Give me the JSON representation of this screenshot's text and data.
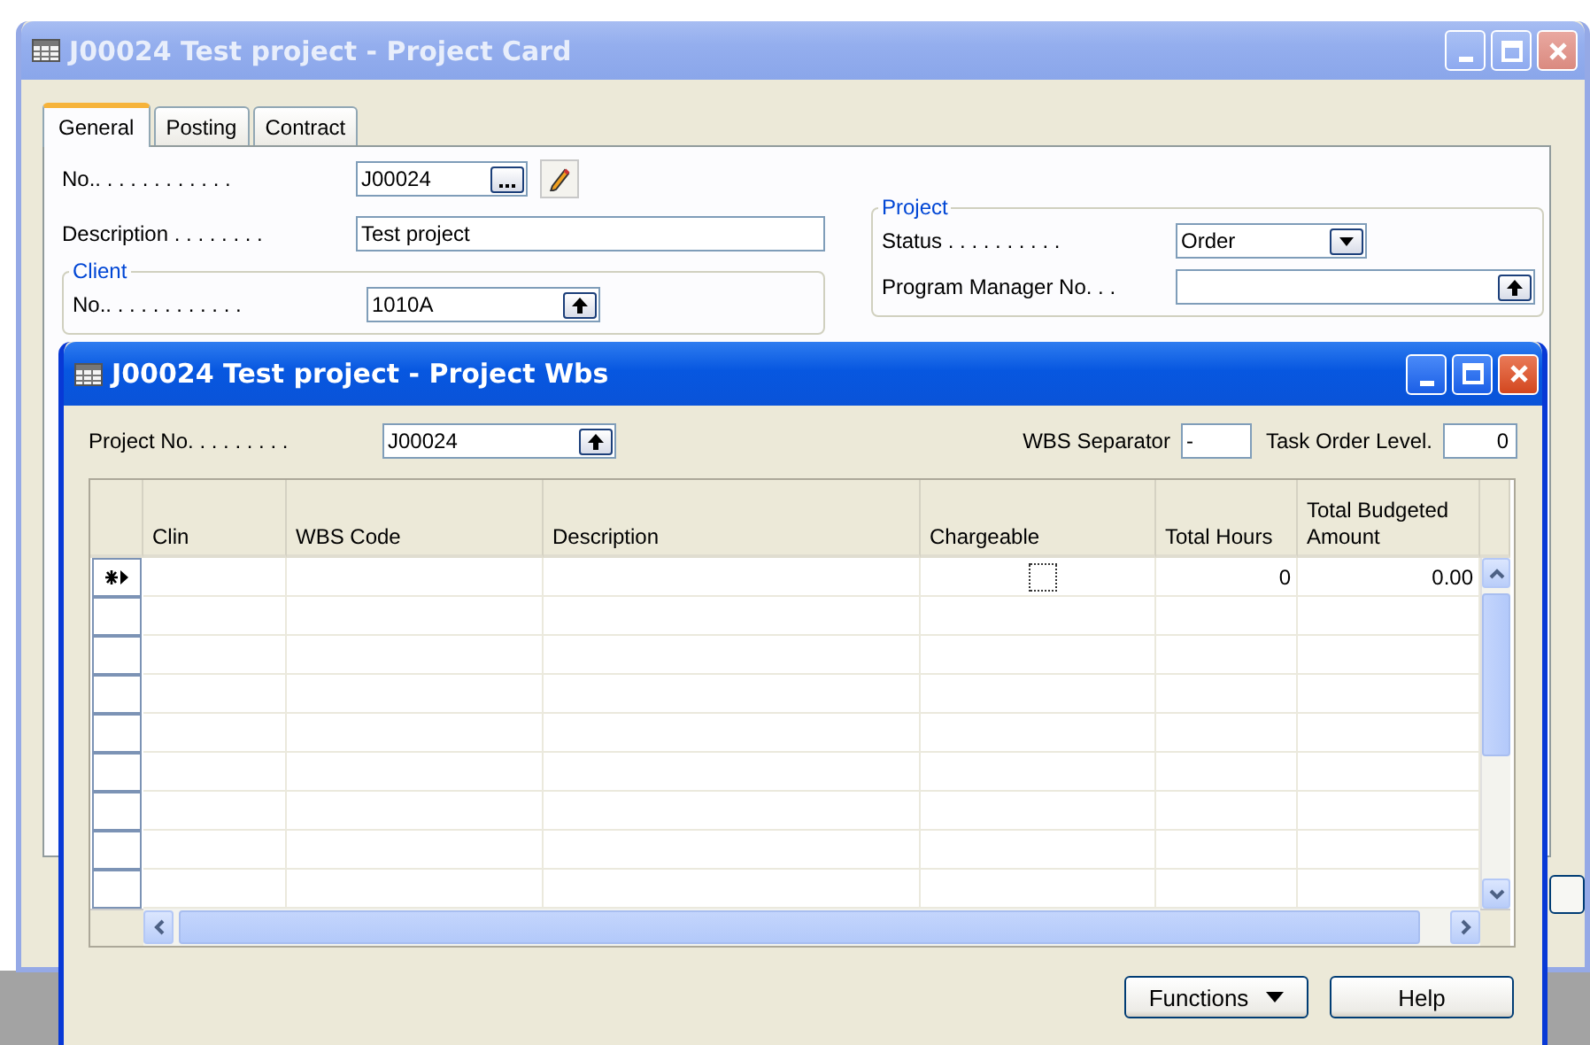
{
  "back_window": {
    "title": "J00024 Test project - Project Card",
    "active": false,
    "tabs": [
      {
        "label": "General",
        "selected": true
      },
      {
        "label": "Posting",
        "selected": false
      },
      {
        "label": "Contract",
        "selected": false
      }
    ],
    "fields": [
      {
        "label": "No.. . . . . . . . . . . .",
        "value": "J00024",
        "kind": "assist"
      },
      {
        "label": "Description . . . . . . . .",
        "value": "Test project",
        "kind": "text"
      }
    ],
    "client_group": {
      "title": "Client",
      "fields": [
        {
          "label": "No.. . . . . . . . . . . .",
          "value": "1010A",
          "kind": "lookup"
        }
      ]
    },
    "project_group": {
      "title": "Project",
      "fields": [
        {
          "label": "Status . . . . . . . . . .",
          "value": "Order",
          "kind": "dropdown"
        },
        {
          "label": "Program Manager No. . .",
          "kind": "lookup"
        }
      ]
    }
  },
  "front_window": {
    "title": "J00024 Test project - Project Wbs",
    "active": true,
    "project_no": {
      "label": "Project No. . . . . . . . .",
      "value": "J00024"
    },
    "wbs_separator": {
      "label": "WBS Separator",
      "value": "-"
    },
    "task_order_level": {
      "label": "Task Order Level.",
      "value": "0"
    },
    "table": {
      "columns": [
        "Clin",
        "WBS Code",
        "Description",
        "Chargeable",
        "Total Hours",
        "Total Budgeted Amount"
      ],
      "rows": [
        {
          "new": true,
          "chargeable": false,
          "total_hours": "0",
          "total_budgeted_amount": "0.00"
        },
        {
          "new": false
        },
        {
          "new": false
        },
        {
          "new": false
        },
        {
          "new": false
        },
        {
          "new": false
        },
        {
          "new": false
        },
        {
          "new": false
        },
        {
          "new": false
        }
      ]
    },
    "buttons": [
      {
        "label": "Functions",
        "kind": "menu"
      },
      {
        "label": "Help",
        "kind": "plain"
      }
    ]
  }
}
